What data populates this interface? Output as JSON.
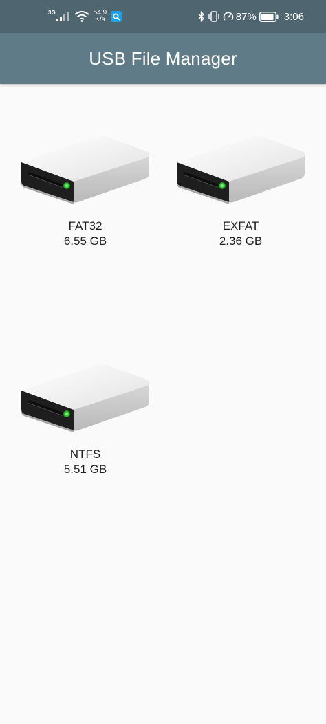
{
  "status_bar": {
    "network_type": "3G",
    "speed_value": "54.9",
    "speed_unit": "K/s",
    "battery_percent": "87%",
    "time": "3:06",
    "icons": [
      "signal-icon",
      "wifi-icon",
      "search-app-icon",
      "bluetooth-icon",
      "vibrate-icon",
      "speedometer-icon",
      "battery-icon"
    ]
  },
  "app_bar": {
    "title": "USB File Manager"
  },
  "drives": [
    {
      "name": "FAT32",
      "size": "6.55 GB",
      "icon": "hard-drive-icon"
    },
    {
      "name": "EXFAT",
      "size": "2.36 GB",
      "icon": "hard-drive-icon"
    },
    {
      "name": "NTFS",
      "size": "5.51 GB",
      "icon": "hard-drive-icon"
    }
  ],
  "colors": {
    "status_bar": "#4f6570",
    "app_bar": "#5f7b87",
    "background": "#fafafa",
    "led": "#3bd13b"
  }
}
